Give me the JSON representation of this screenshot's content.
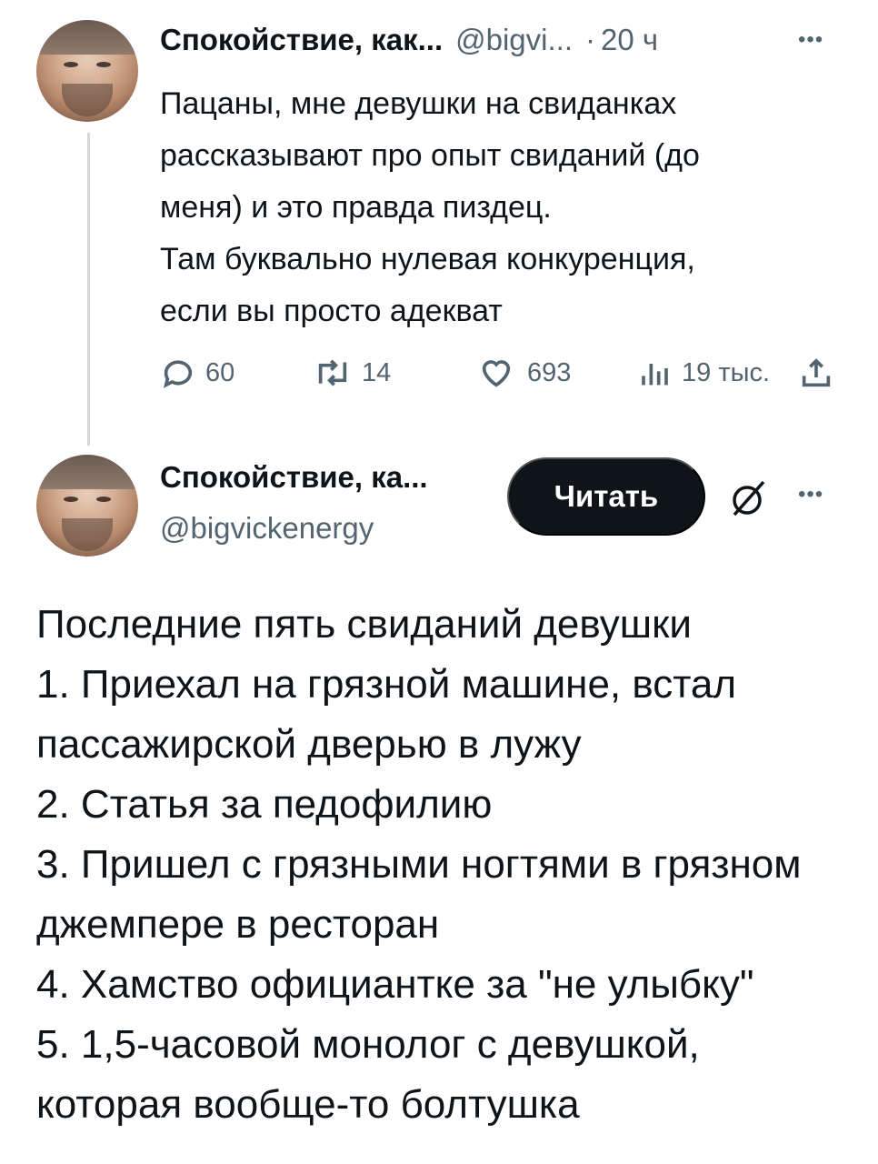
{
  "tweet1": {
    "author_name": "Спокойствие, как...",
    "handle": "@bigvi...",
    "separator": "·",
    "time": "20 ч",
    "more": "•••",
    "lines": [
      "Пацаны, мне девушки на свиданках",
      "рассказывают про опыт свиданий (до",
      "меня) и это правда пиздец.",
      "Там буквально нулевая конкуренция,",
      "если вы просто адекват"
    ],
    "stats": {
      "replies": "60",
      "reposts": "14",
      "likes": "693",
      "views": "19 тыс."
    }
  },
  "tweet2": {
    "author_name": "Спокойствие, ка...",
    "handle": "@bigvickenergy",
    "read_button": "Читать",
    "more": "•••",
    "lines": [
      "Последние пять свиданий девушки",
      "1. Приехал на грязной машине, встал",
      "пассажирской дверью в лужу",
      "2. Статья за педофилию",
      "3. Пришел с грязными ногтями в грязном",
      "джемпере в ресторан",
      "4. Хамство официантке за \"не улыбку\"",
      "5. 1,5-часовой монолог с девушкой,",
      "которая вообще-то болтушка"
    ]
  },
  "icons": [
    "avatar",
    "reply-icon",
    "repost-icon",
    "like-icon",
    "views-icon",
    "share-icon",
    "more-icon",
    "grok-icon"
  ],
  "colors": {
    "text": "#0f1419",
    "secondary": "#536471",
    "button_bg": "#0f1419",
    "thread_line": "#d4d8db"
  }
}
